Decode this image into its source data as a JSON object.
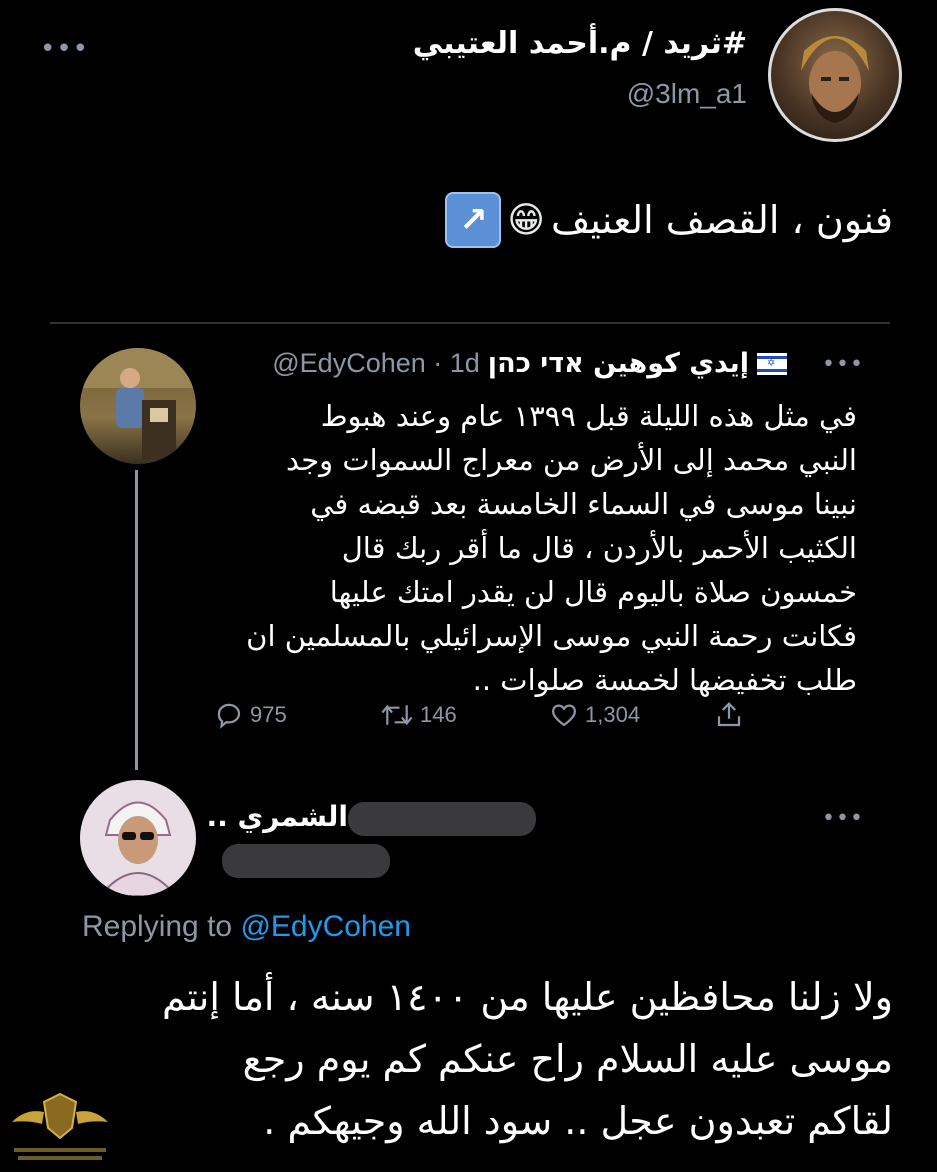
{
  "main_tweet": {
    "display_name": "#ثريد / م.أحمد العتيبي",
    "handle": "@3lm_a1",
    "text": "فنون ، القصف العنيف",
    "emoji": "😁",
    "link_arrow": "↗"
  },
  "quoted_tweet": {
    "display_name": "إيدي كوهين אדי כהן",
    "flag": "🇮🇱",
    "handle_time": "@EdyCohen · 1d",
    "lines": [
      "في مثل هذه الليلة قبل ١٣٩٩ عام وعند هبوط",
      "النبي محمد إلى الأرض من معراج السموات وجد",
      "نبينا موسى في السماء الخامسة بعد قبضه في",
      "الكثيب الأحمر بالأردن ، قال ما أقر ربك قال",
      "خمسون صلاة باليوم قال لن يقدر امتك عليها",
      "فكانت رحمة النبي موسى الإسرائيلي بالمسلمين ان",
      "طلب تخفيضها لخمسة صلوات .."
    ],
    "replies": "975",
    "retweets": "146",
    "likes": "1,304"
  },
  "reply_tweet": {
    "display_name": "الشمري ..",
    "replying_prefix": "Replying to",
    "replying_to": "@EdyCohen",
    "lines": [
      "ولا زلنا محافظين عليها من ١٤٠٠ سنه ، أما إنتم",
      "موسى عليه السلام راح عنكم كم يوم رجع",
      "لقاكم تعبدون عجل .. سود الله وجيهكم ."
    ]
  },
  "icons": {
    "more": "•••",
    "reply": "reply-icon",
    "retweet": "retweet-icon",
    "like": "heart-icon",
    "share": "share-icon"
  },
  "colors": {
    "background": "#000000",
    "text": "#e7e9ea",
    "muted": "#8b98a5",
    "link": "#1d9bf0"
  }
}
